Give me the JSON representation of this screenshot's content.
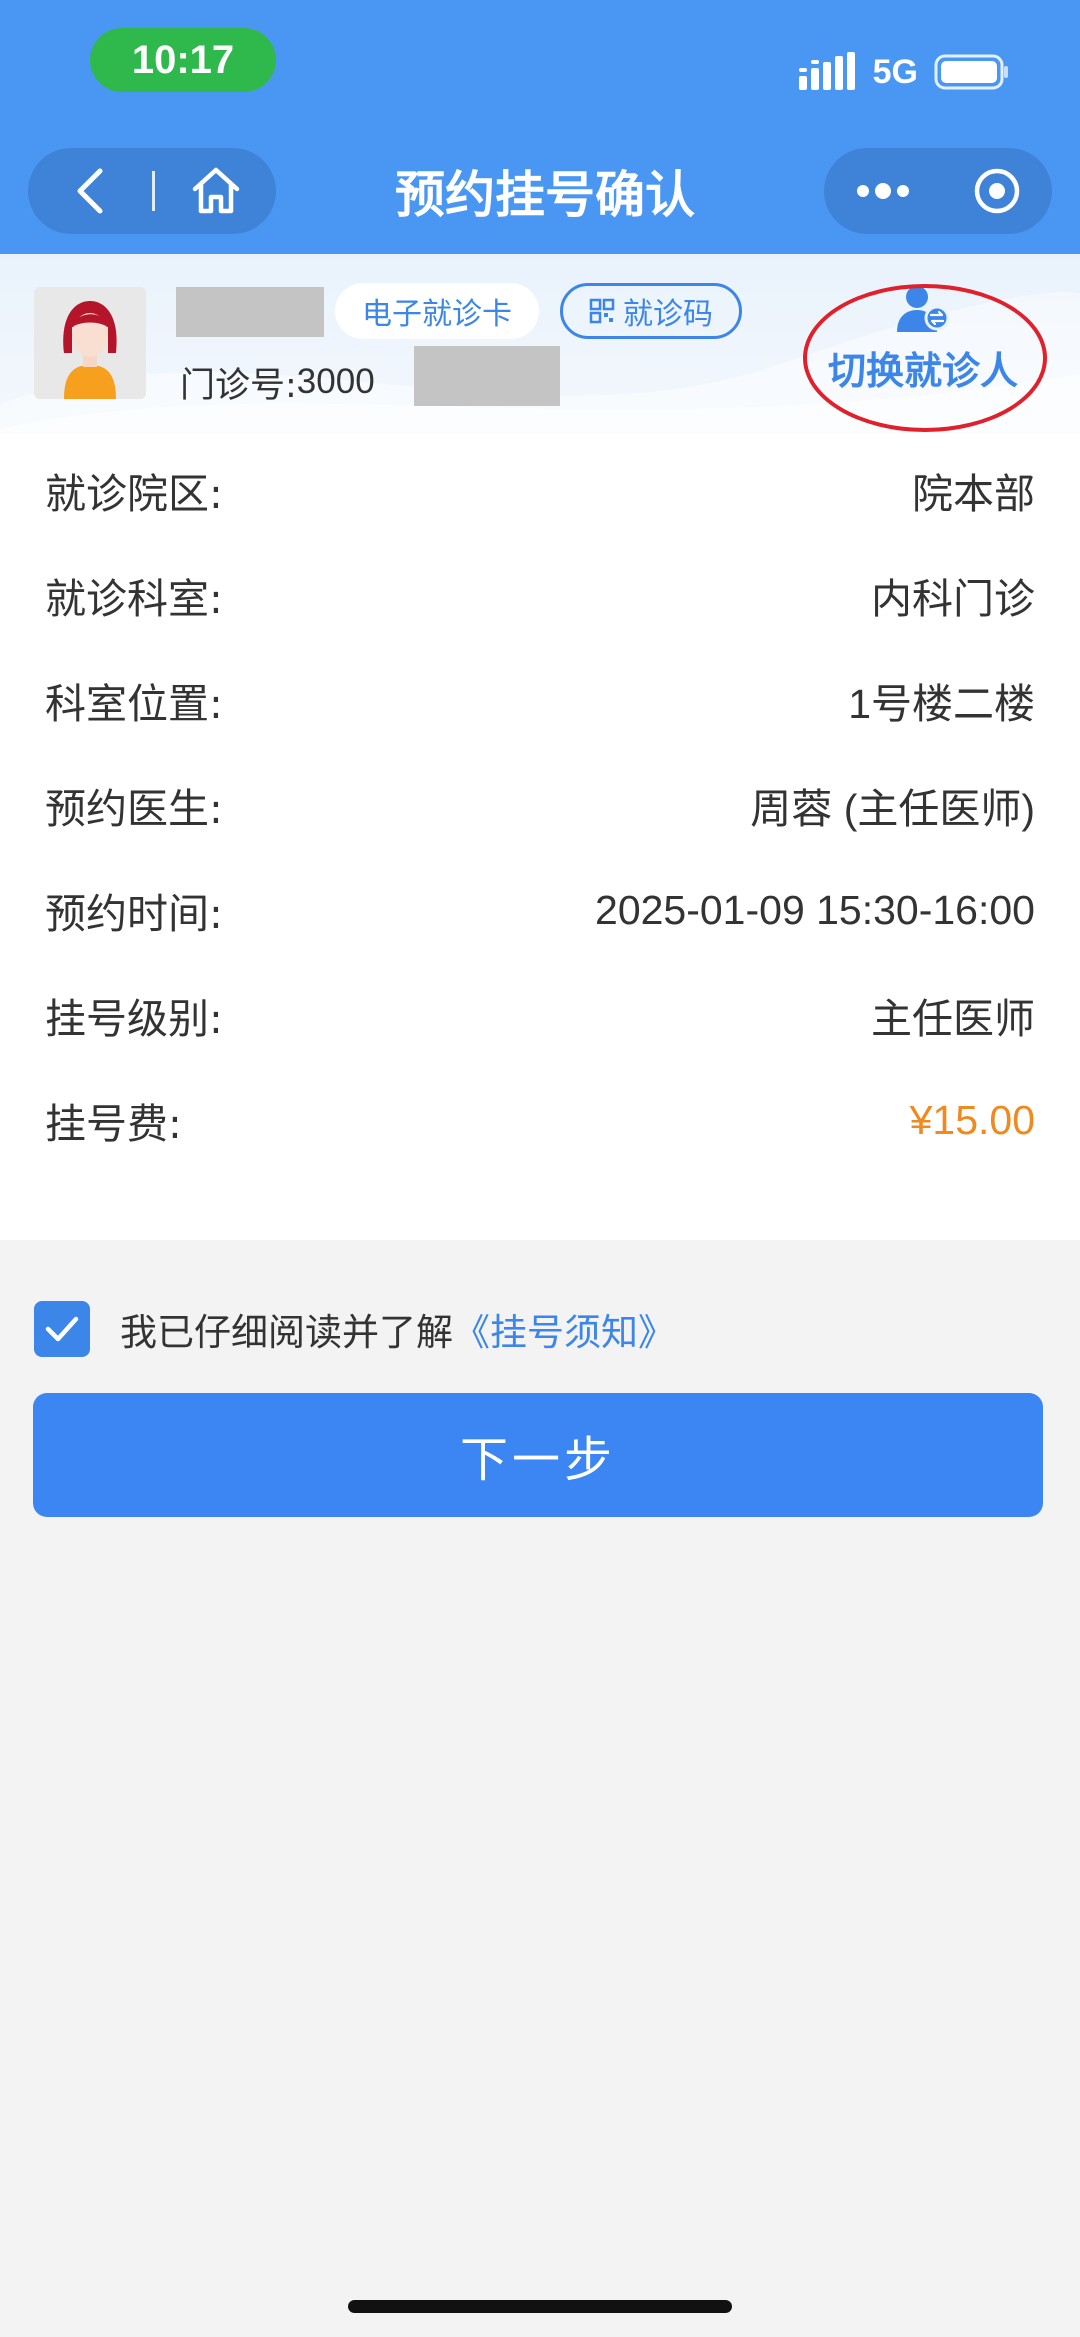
{
  "status_bar": {
    "time": "10:17",
    "network": "5G",
    "icons": [
      "signal-icon",
      "battery-icon"
    ]
  },
  "nav": {
    "title": "预约挂号确认",
    "icons": [
      "back-icon",
      "home-icon",
      "more-icon",
      "target-icon"
    ]
  },
  "patient": {
    "ecard_label": "电子就诊卡",
    "code_label": "就诊码",
    "clinic_no_label": "门诊号: ",
    "clinic_no_value": "3000",
    "switch_label": "切换就诊人"
  },
  "info_rows": [
    {
      "label": "就诊院区:",
      "value": "院本部"
    },
    {
      "label": "就诊科室:",
      "value": "内科门诊"
    },
    {
      "label": "科室位置:",
      "value": "1号楼二楼"
    },
    {
      "label": "预约医生:",
      "value": "周蓉 (主任医师)"
    },
    {
      "label": "预约时间:",
      "value": "2025-01-09 15:30-16:00"
    },
    {
      "label": "挂号级别:",
      "value": "主任医师"
    },
    {
      "label": "挂号费:",
      "value": "¥15.00"
    }
  ],
  "agreement": {
    "text": "我已仔细阅读并了解",
    "link": "《挂号须知》",
    "checked": true
  },
  "next_button": "下一步",
  "colors": {
    "header_blue": "#4a97f3",
    "accent_blue": "#3b86e8",
    "fee_orange": "#ef8a1f",
    "time_green": "#2fb94c",
    "annotation_red": "#e0202a"
  }
}
